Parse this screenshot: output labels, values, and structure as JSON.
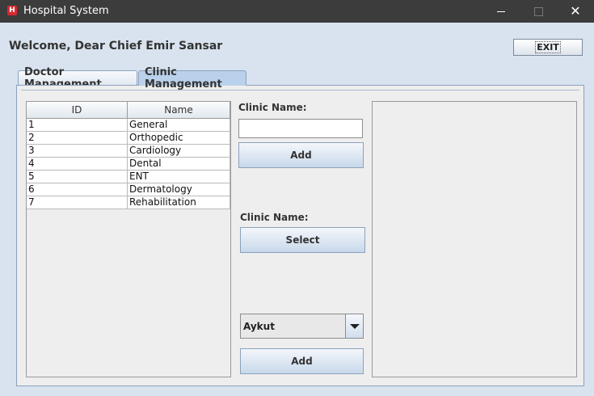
{
  "window": {
    "title": "Hospital System",
    "icon_letter": "H",
    "close_glyph": "✕"
  },
  "header": {
    "welcome": "Welcome, Dear Chief Emir Sansar",
    "exit_label": "EXIT"
  },
  "tabs": [
    {
      "label": "Doctor Management",
      "selected": false
    },
    {
      "label": "Clinic Management",
      "selected": true
    }
  ],
  "clinic_table": {
    "columns": [
      "ID",
      "Name"
    ],
    "rows": [
      [
        "1",
        "General"
      ],
      [
        "2",
        "Orthopedic"
      ],
      [
        "3",
        "Cardiology"
      ],
      [
        "4",
        "Dental"
      ],
      [
        "5",
        "ENT"
      ],
      [
        "6",
        "Dermatology"
      ],
      [
        "7",
        "Rehabilitation"
      ]
    ]
  },
  "add_clinic": {
    "label": "Clinic Name:",
    "input_value": "",
    "button_label": "Add"
  },
  "select_clinic": {
    "label": "Clinic Name:",
    "button_label": "Select"
  },
  "doctor_assign": {
    "selected_doctor": "Aykut",
    "button_label": "Add"
  },
  "colors": {
    "titlebar": "#3c3c3c",
    "window_bg": "#d9e3ef",
    "selected_tab": "#b9d1ea",
    "app_icon": "#d8292f"
  }
}
